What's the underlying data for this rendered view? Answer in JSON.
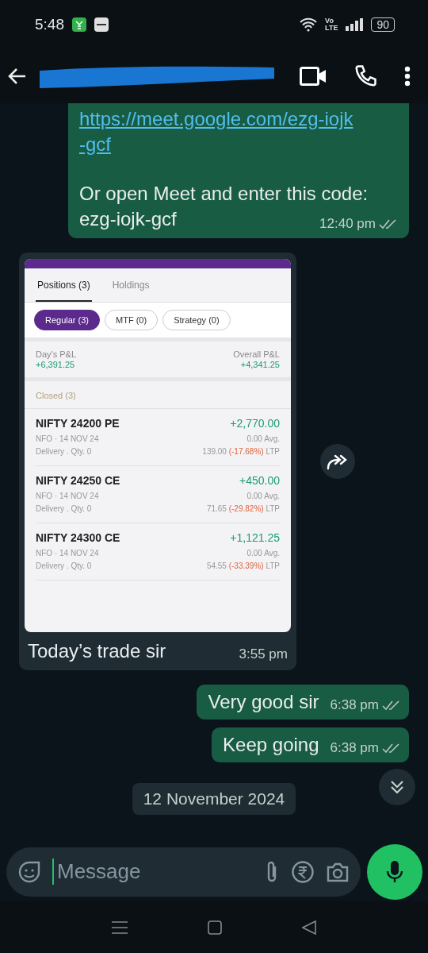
{
  "status_bar": {
    "time": "5:48",
    "volte_top": "Vo",
    "volte_bottom": "LTE",
    "battery": "90"
  },
  "messages": [
    {
      "kind": "link_text",
      "outgoing": true,
      "link_lines": [
        "https://meet.google.com/ezg-iojk",
        "-gcf"
      ],
      "lines": [
        "Or open Meet and enter this code:",
        "ezg-iojk-gcf"
      ],
      "time": "12:40 pm",
      "read": false
    },
    {
      "kind": "image",
      "outgoing": false,
      "caption": "Today’s trade sir",
      "time": "3:55 pm",
      "screenshot": {
        "tabs": [
          {
            "label": "Positions (3)",
            "selected": true
          },
          {
            "label": "Holdings",
            "selected": false
          }
        ],
        "chips": [
          {
            "label": "Regular (3)",
            "selected": true
          },
          {
            "label": "MTF (0)",
            "selected": false
          },
          {
            "label": "Strategy (0)",
            "selected": false
          }
        ],
        "day_pnl_label": "Day's P&L",
        "day_pnl": "+6,391.25",
        "overall_pnl_label": "Overall P&L",
        "overall_pnl": "+4,341.25",
        "section": "Closed (3)",
        "positions": [
          {
            "name": "NIFTY 24200 PE",
            "pnl": "+2,770.00",
            "exchange": "NFO · 14 NOV 24",
            "avg": "0.00 Avg.",
            "product": "Delivery . Qty. 0",
            "ltp": "139.00",
            "change": "(-17.68%)",
            "ltp_label": "LTP"
          },
          {
            "name": "NIFTY 24250 CE",
            "pnl": "+450.00",
            "exchange": "NFO · 14 NOV 24",
            "avg": "0.00 Avg.",
            "product": "Delivery . Qty. 0",
            "ltp": "71.65",
            "change": "(-29.82%)",
            "ltp_label": "LTP"
          },
          {
            "name": "NIFTY 24300 CE",
            "pnl": "+1,121.25",
            "exchange": "NFO · 14 NOV 24",
            "avg": "0.00 Avg.",
            "product": "Delivery . Qty. 0",
            "ltp": "54.55",
            "change": "(-33.39%)",
            "ltp_label": "LTP"
          }
        ]
      }
    },
    {
      "kind": "text",
      "outgoing": true,
      "text": "Very good sir",
      "time": "6:38 pm",
      "read": false
    },
    {
      "kind": "text",
      "outgoing": true,
      "text": "Keep going",
      "time": "6:38 pm",
      "read": false
    }
  ],
  "date_chip": "12 November 2024",
  "composer": {
    "placeholder": "Message"
  }
}
